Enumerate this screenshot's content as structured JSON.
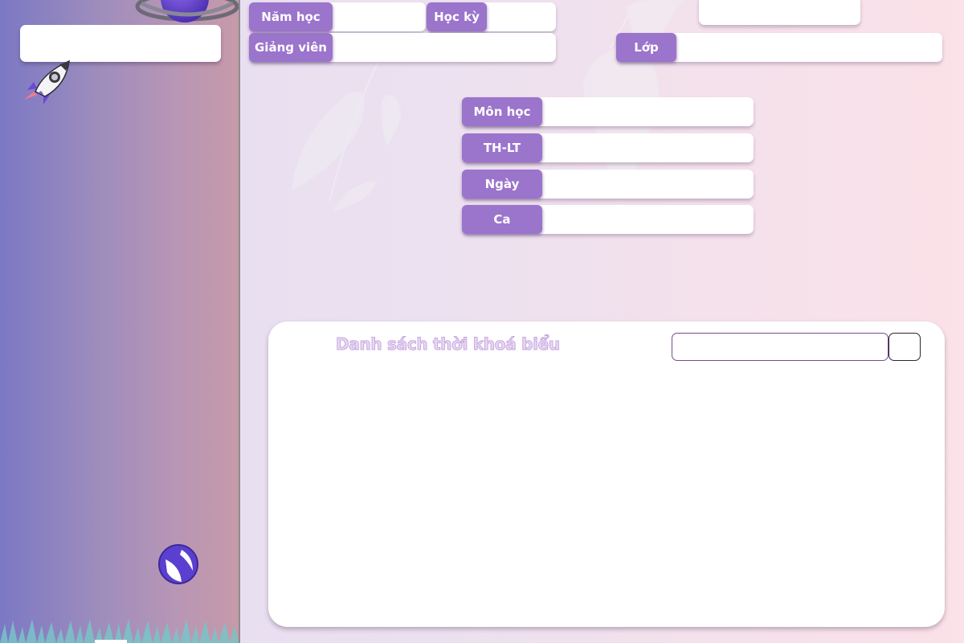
{
  "form": {
    "nam_hoc": {
      "label": "Năm học",
      "value": "",
      "placeholder": ""
    },
    "hoc_ky": {
      "label": "Học kỳ",
      "value": "",
      "placeholder": ""
    },
    "giang_vien": {
      "label": "Giảng viên",
      "value": "",
      "placeholder": ""
    },
    "lop": {
      "label": "Lớp",
      "value": "",
      "placeholder": ""
    },
    "mon_hoc": {
      "label": "Môn học",
      "value": "",
      "placeholder": ""
    },
    "th_lt": {
      "label": "TH-LT",
      "value": "",
      "placeholder": ""
    },
    "ngay": {
      "label": "Ngày",
      "value": "",
      "placeholder": ""
    },
    "ca": {
      "label": "Ca",
      "value": "",
      "placeholder": ""
    }
  },
  "list": {
    "title": "Danh sách thời khoá biểu",
    "search": {
      "value": "",
      "placeholder": ""
    },
    "search_button_label": ""
  },
  "sidebar": {
    "top_box_text": ""
  },
  "icons": {
    "planet": "planet-icon",
    "rocket": "rocket-icon",
    "ball": "ball-icon",
    "grass": "grass-decoration",
    "feathers": "feather-decoration"
  },
  "colors": {
    "accent": "#9b74cc",
    "sidebar_start": "#7b78c4",
    "sidebar_end": "#c69aa8",
    "title_text": "#e8d8f3",
    "search_border": "#7a4c8f"
  }
}
